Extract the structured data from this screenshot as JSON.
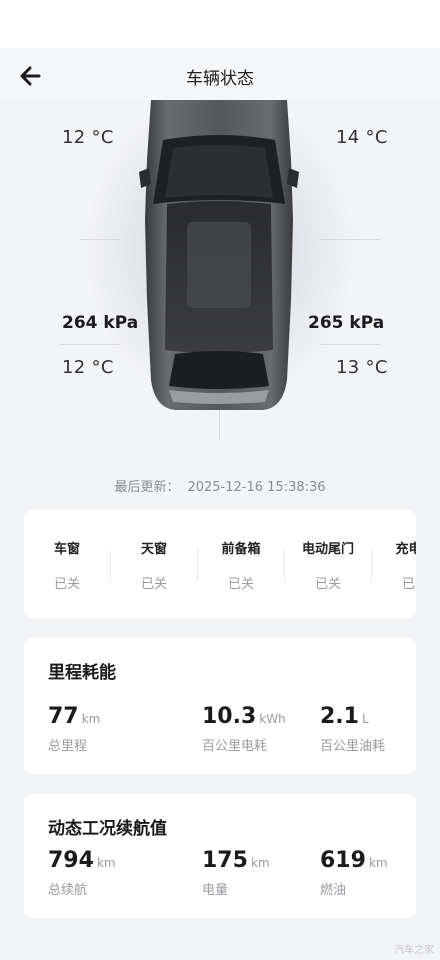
{
  "header": {
    "title": "车辆状态"
  },
  "tires": {
    "front_left": {
      "temp": "12 °C"
    },
    "front_right": {
      "temp": "14 °C"
    },
    "rear_left": {
      "pressure": "264 kPa",
      "temp": "12 °C"
    },
    "rear_right": {
      "pressure": "265 kPa",
      "temp": "13 °C"
    }
  },
  "last_update": {
    "label": "最后更新：",
    "time": "2025-12-16 15:38:36"
  },
  "status": {
    "items": [
      {
        "label": "车窗",
        "value": "已关"
      },
      {
        "label": "天窗",
        "value": "已关"
      },
      {
        "label": "前备箱",
        "value": "已关"
      },
      {
        "label": "电动尾门",
        "value": "已关"
      },
      {
        "label": "充电口",
        "value": "已关"
      }
    ]
  },
  "mileage": {
    "title": "里程耗能",
    "metrics": [
      {
        "value": "77",
        "unit": "km",
        "label": "总里程"
      },
      {
        "value": "10.3",
        "unit": "kWh",
        "label": "百公里电耗"
      },
      {
        "value": "2.1",
        "unit": "L",
        "label": "百公里油耗"
      }
    ]
  },
  "range": {
    "title": "动态工况续航值",
    "metrics": [
      {
        "value": "794",
        "unit": "km",
        "label": "总续航"
      },
      {
        "value": "175",
        "unit": "km",
        "label": "电量"
      },
      {
        "value": "619",
        "unit": "km",
        "label": "燃油"
      }
    ]
  },
  "watermark": "汽车之家"
}
